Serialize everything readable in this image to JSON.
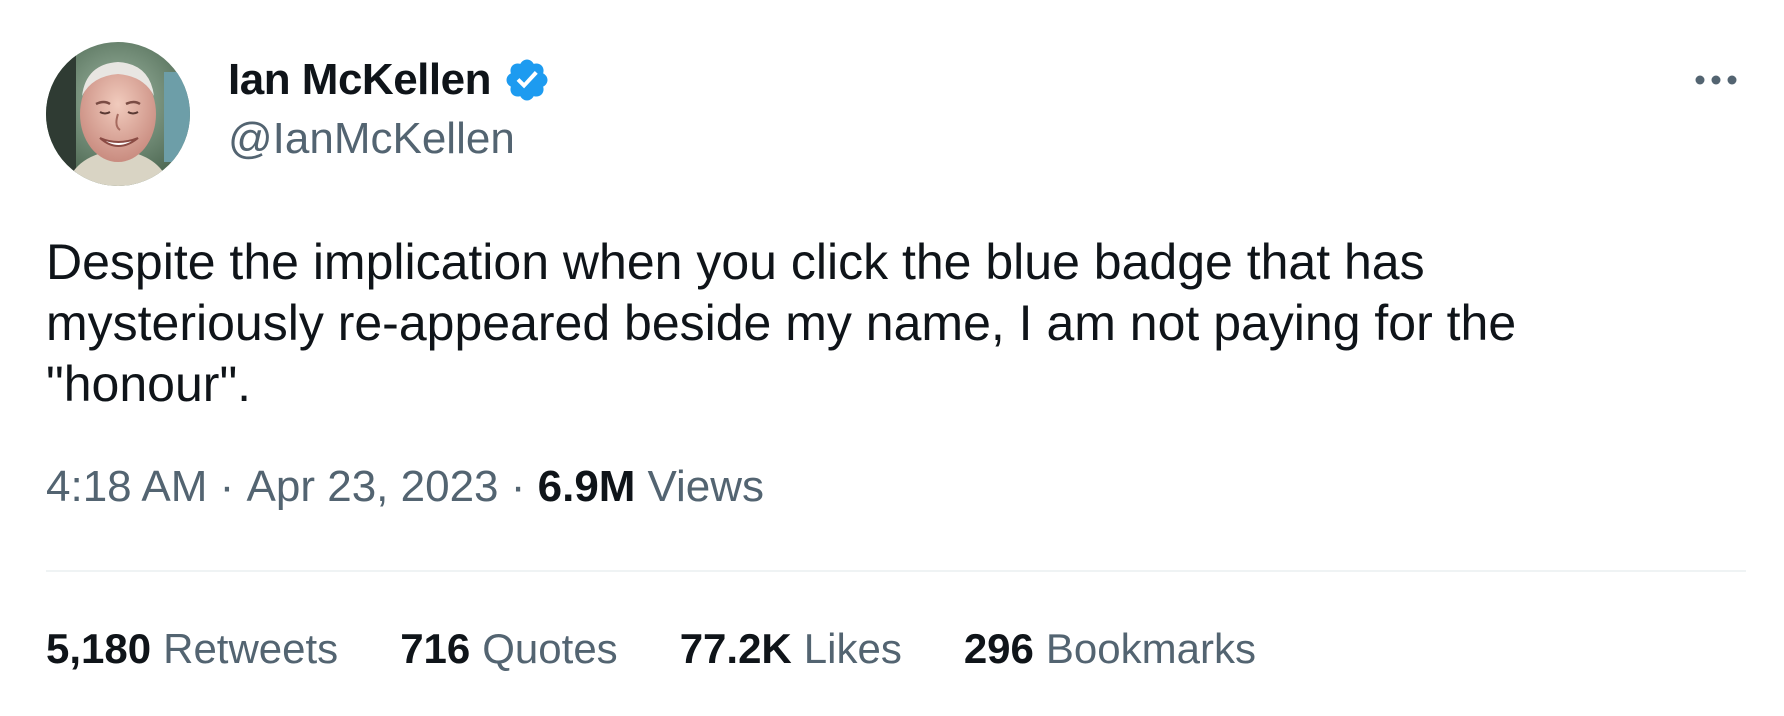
{
  "tweet": {
    "author": {
      "display_name": "Ian McKellen",
      "handle": "@IanMcKellen",
      "verified": true,
      "verified_color": "#1d9bf0",
      "avatar_icon": "profile-photo"
    },
    "more_icon": "more-horizontal-icon",
    "text": "Despite the implication when you click the blue badge that has\nmysteriously re-appeared beside my name, I am not paying for the\n\"honour\".",
    "meta": {
      "time": "4:18 AM",
      "separator": " · ",
      "date": "Apr 23, 2023",
      "views_count": "6.9M",
      "views_label": "Views"
    },
    "stats": [
      {
        "count": "5,180",
        "label": "Retweets"
      },
      {
        "count": "716",
        "label": "Quotes"
      },
      {
        "count": "77.2K",
        "label": "Likes"
      },
      {
        "count": "296",
        "label": "Bookmarks"
      }
    ]
  }
}
